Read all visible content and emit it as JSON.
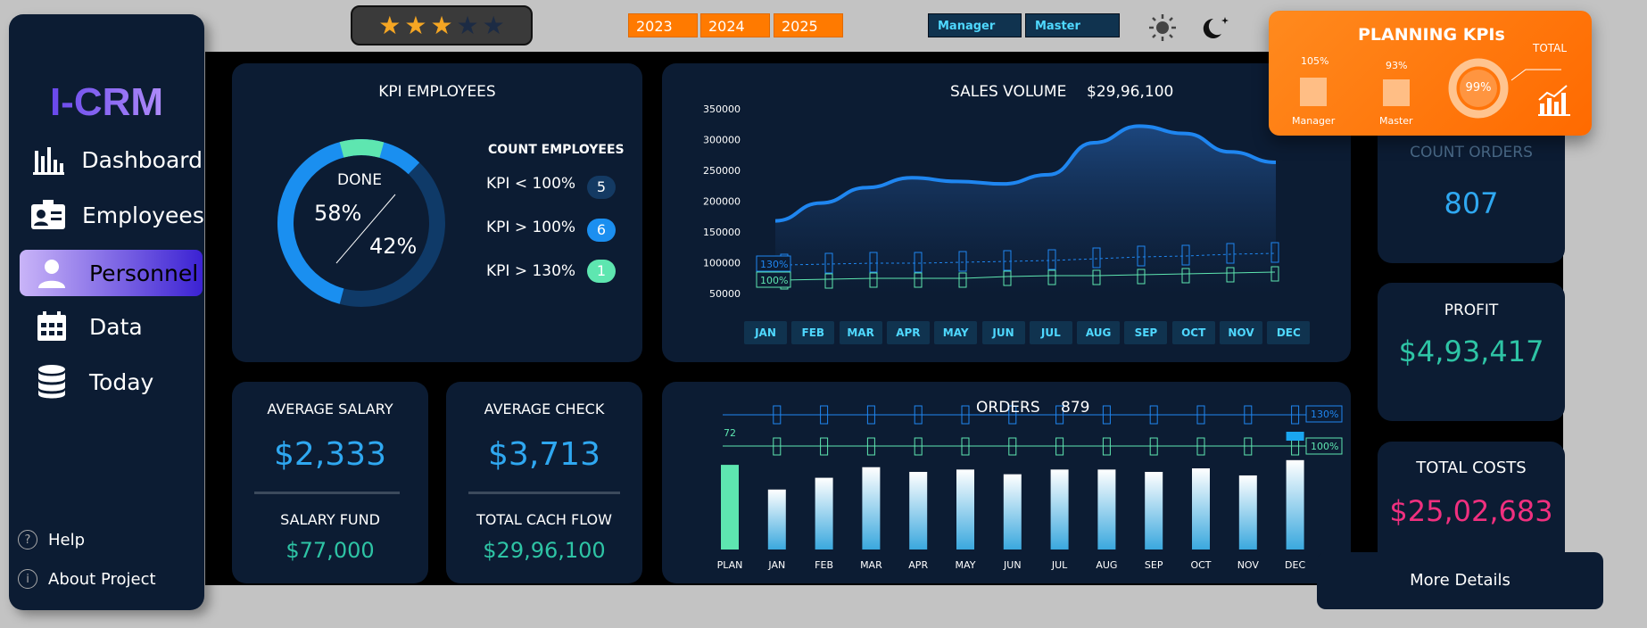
{
  "app": {
    "logo": "I-CRM"
  },
  "sidebar": {
    "items": [
      {
        "label": "Dashboard",
        "icon": "bar-chart-icon"
      },
      {
        "label": "Employees",
        "icon": "id-card-icon"
      },
      {
        "label": "Personnel",
        "icon": "person-icon",
        "active": true
      },
      {
        "label": "Data",
        "icon": "calendar-icon"
      },
      {
        "label": "Today",
        "icon": "database-icon"
      }
    ],
    "footer": [
      {
        "label": "Help",
        "icon": "question-icon"
      },
      {
        "label": "About Project",
        "icon": "info-icon"
      }
    ]
  },
  "topbar": {
    "rating": 3,
    "rating_max": 5,
    "years": [
      "2023",
      "2024",
      "2025"
    ],
    "roles": [
      "Manager",
      "Master"
    ],
    "theme_icons": [
      "sun-icon",
      "moon-icon"
    ]
  },
  "kpi_employees": {
    "title": "KPI EMPLOYEES",
    "done_label": "DONE",
    "done_pct": "58%",
    "rest_pct": "42%",
    "count_title": "COUNT EMPLOYEES",
    "rows": [
      {
        "label": "KPI < 100%",
        "count": "5",
        "color": "#143a63"
      },
      {
        "label": "KPI > 100%",
        "count": "6",
        "color": "#1b8ff0"
      },
      {
        "label": "KPI > 130%",
        "count": "1",
        "color": "#5ee6b0"
      }
    ]
  },
  "sales": {
    "title": "SALES VOLUME",
    "total": "$29,96,100",
    "months": [
      "JAN",
      "FEB",
      "MAR",
      "APR",
      "MAY",
      "JUN",
      "JUL",
      "AUG",
      "SEP",
      "OCT",
      "NOV",
      "DEC"
    ],
    "ref_130": "130%",
    "ref_100": "100%"
  },
  "average_salary": {
    "title": "AVERAGE SALARY",
    "value": "$2,333",
    "sub_title": "SALARY  FUND",
    "sub_value": "$77,000"
  },
  "average_check": {
    "title": "AVERAGE CHECK",
    "value": "$3,713",
    "sub_title": "TOTAL CACH FLOW",
    "sub_value": "$29,96,100"
  },
  "orders": {
    "title": "ORDERS",
    "total": "879",
    "plan_value": "72",
    "ref_130": "130%",
    "ref_100": "100%"
  },
  "count_orders": {
    "title": "COUNT ORDERS",
    "value": "807"
  },
  "profit": {
    "title": "PROFIT",
    "value": "$4,93,417"
  },
  "total_costs": {
    "title": "TOTAL COSTS",
    "value": "$25,02,683"
  },
  "planning_kpis": {
    "title": "PLANNING KPIs",
    "manager_pct": "105%",
    "manager_label": "Manager",
    "master_pct": "93%",
    "master_label": "Master",
    "total_pct": "99%",
    "total_label": "TOTAL"
  },
  "more_details": "More Details",
  "chart_data": [
    {
      "type": "area",
      "title": "SALES VOLUME",
      "categories": [
        "JAN",
        "FEB",
        "MAR",
        "APR",
        "MAY",
        "JUN",
        "JUL",
        "AUG",
        "SEP",
        "OCT",
        "NOV",
        "DEC"
      ],
      "series": [
        {
          "values": [
            168000,
            197000,
            222000,
            238000,
            232000,
            228000,
            243000,
            295000,
            322000,
            310000,
            280000,
            263000
          ]
        }
      ],
      "ylim": [
        50000,
        350000
      ],
      "yticks": [
        50000,
        100000,
        150000,
        200000,
        250000,
        300000,
        350000
      ],
      "grid": false
    },
    {
      "type": "bar",
      "title": "ORDERS",
      "categories": [
        "PLAN",
        "JAN",
        "FEB",
        "MAR",
        "APR",
        "MAY",
        "JUN",
        "JUL",
        "AUG",
        "SEP",
        "OCT",
        "NOV",
        "DEC"
      ],
      "values": [
        72,
        51,
        61,
        70,
        66,
        68,
        64,
        68,
        68,
        66,
        69,
        63,
        76
      ],
      "ylim": [
        0,
        100
      ],
      "grid": false
    }
  ]
}
